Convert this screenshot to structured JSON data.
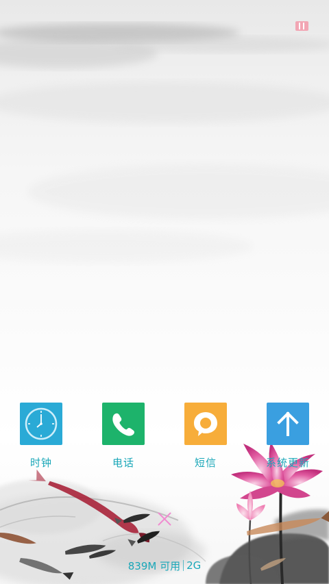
{
  "apps": [
    {
      "label": "时钟",
      "icon": "clock-icon",
      "color": "#2aaad6"
    },
    {
      "label": "电话",
      "icon": "phone-icon",
      "color": "#1db36b"
    },
    {
      "label": "短信",
      "icon": "message-icon",
      "color": "#f7ad3a"
    },
    {
      "label": "系统更新",
      "icon": "arrow-up-icon",
      "color": "#3a9fe0"
    }
  ],
  "status": {
    "memory": "839M 可用",
    "network": "2G"
  },
  "colors": {
    "label_text": "#1aa7b8",
    "close_accent": "#f08bd0",
    "top_indicator": "#f2a6b4"
  }
}
